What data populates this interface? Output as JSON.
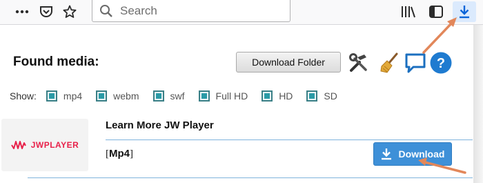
{
  "toolbar": {
    "menu_icon": "more-dots-icon",
    "pocket_icon": "pocket-icon",
    "bookmark_icon": "star-icon",
    "search": {
      "placeholder": "Search",
      "value": ""
    },
    "library_icon": "library-icon",
    "sidebar_icon": "sidebar-icon",
    "download_icon": "download-arrow-icon"
  },
  "panel": {
    "heading": "Found media:",
    "download_folder_label": "Download Folder",
    "tools": [
      "tools-icon",
      "broom-icon",
      "chat-bubble-icon",
      "help-icon"
    ],
    "show_label": "Show:",
    "filters": [
      {
        "label": "mp4",
        "checked": true
      },
      {
        "label": "webm",
        "checked": true
      },
      {
        "label": "swf",
        "checked": true
      },
      {
        "label": "Full HD",
        "checked": true
      },
      {
        "label": "HD",
        "checked": true
      },
      {
        "label": "SD",
        "checked": true
      }
    ],
    "media": {
      "title": "Learn More JW Player",
      "format": "Mp4",
      "thumbnail_logo": "JWPLAYER",
      "download_label": "Download"
    }
  },
  "colors": {
    "accent_blue": "#3e90d8",
    "checkbox_teal": "#2a9aa6",
    "annotation_arrow": "#e2875a",
    "logo_red": "#e8214a"
  }
}
